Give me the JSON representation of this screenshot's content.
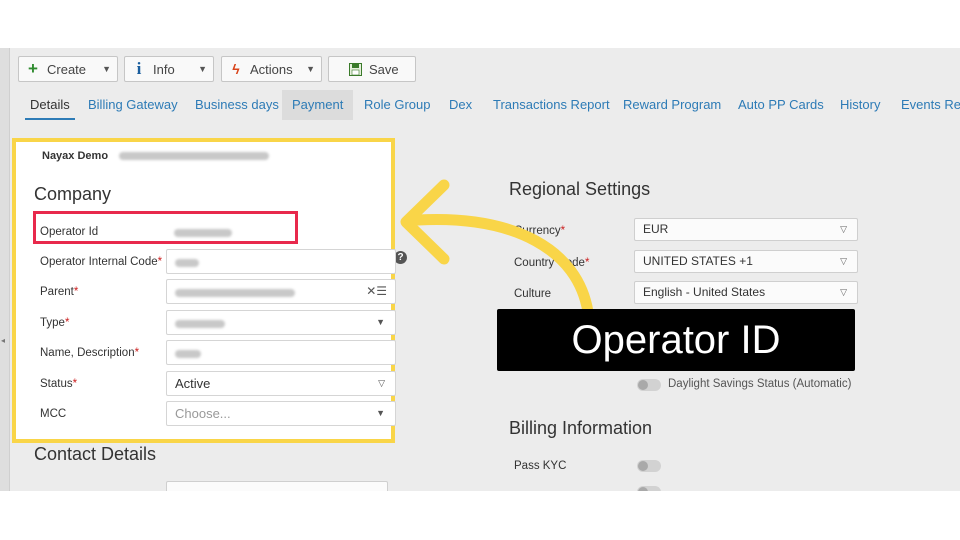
{
  "toolbar": {
    "create_label": "Create",
    "info_label": "Info",
    "actions_label": "Actions",
    "save_label": "Save"
  },
  "tabs": [
    {
      "label": "Details"
    },
    {
      "label": "Billing Gateway"
    },
    {
      "label": "Business days"
    },
    {
      "label": "Payment"
    },
    {
      "label": "Role Group"
    },
    {
      "label": "Dex"
    },
    {
      "label": "Transactions Report"
    },
    {
      "label": "Reward Program"
    },
    {
      "label": "Auto PP Cards"
    },
    {
      "label": "History"
    },
    {
      "label": "Events Rep"
    }
  ],
  "company": {
    "header_name": "Nayax Demo",
    "section_title": "Company",
    "fields": {
      "operator_id": "Operator Id",
      "operator_internal_code": "Operator Internal Code",
      "parent": "Parent",
      "type": "Type",
      "name_description": "Name, Description",
      "status": "Status",
      "mcc": "MCC"
    },
    "status_value": "Active",
    "mcc_placeholder": "Choose..."
  },
  "contact": {
    "section_title": "Contact Details"
  },
  "regional": {
    "section_title": "Regional Settings",
    "currency_label": "Currency",
    "country_code_label": "Country Code",
    "culture_label": "Culture",
    "currency_value": "EUR",
    "country_code_value": "UNITED STATES +1",
    "culture_value": "English - United States",
    "daylight_label": "Daylight Savings Status (Automatic)"
  },
  "billing": {
    "section_title": "Billing Information",
    "pass_kyc_label": "Pass KYC"
  },
  "callout": {
    "text": "Operator ID"
  },
  "colors": {
    "highlight_yellow": "#f9d548",
    "highlight_red": "#e8294c",
    "tab_blue": "#2d7bb6",
    "create_green": "#2e8b2e"
  },
  "icons": {
    "create": "plus-icon",
    "info": "info-icon",
    "actions": "bolt-icon",
    "save": "floppy-icon"
  }
}
